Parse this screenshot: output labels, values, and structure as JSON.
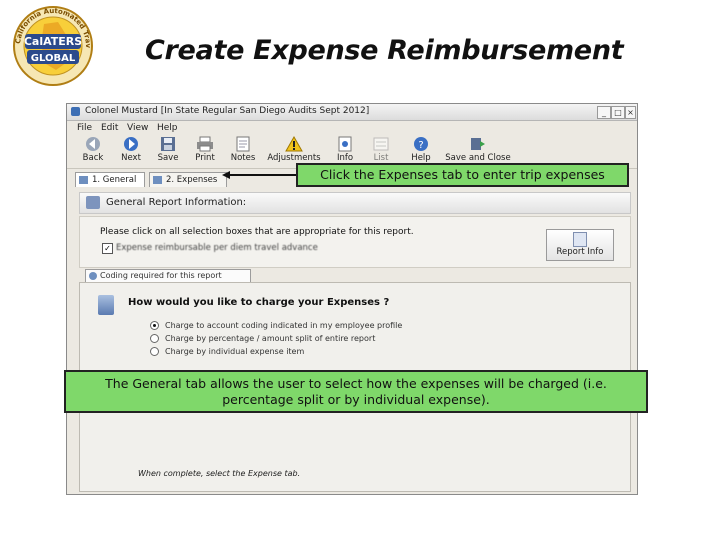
{
  "slide": {
    "title": "Create Expense Reimbursement",
    "logo_top_text": "California Automated Travel Expense",
    "logo_line1": "CalATERS",
    "logo_line2": "GLOBAL"
  },
  "window": {
    "title": "Colonel Mustard [In State Regular San Diego Audits Sept 2012]",
    "controls": [
      "_",
      "□",
      "×"
    ],
    "menu": [
      "File",
      "Edit",
      "View",
      "Help"
    ],
    "toolbar": [
      {
        "label": "Back",
        "icon": "back-arrow-icon"
      },
      {
        "label": "Next",
        "icon": "next-arrow-icon"
      },
      {
        "label": "Save",
        "icon": "save-disk-icon"
      },
      {
        "label": "Print",
        "icon": "printer-icon"
      },
      {
        "label": "Notes",
        "icon": "notes-icon"
      },
      {
        "label": "Adjustments",
        "icon": "warning-icon"
      },
      {
        "label": "Info",
        "icon": "info-icon"
      },
      {
        "label": "List",
        "icon": "list-icon"
      },
      {
        "label": "Help",
        "icon": "help-icon"
      },
      {
        "label": "Save and Close",
        "icon": "save-close-icon"
      }
    ],
    "tabs": [
      "1. General",
      "2. Expenses"
    ],
    "section_header": "General Report Information:",
    "panel_instruction": "Please click on all selection boxes that are appropriate for this report.",
    "panel_checkbox_label": "Expense reimbursable per diem travel advance",
    "report_info_label": "Report Info",
    "subtab": "Coding required for this report",
    "coding_question": "How would you like to charge your Expenses ?",
    "radio_options": [
      "Charge to account coding indicated in my employee profile",
      "Charge by percentage / amount split of entire report",
      "Charge by individual expense item"
    ],
    "selected_option_index": 0,
    "footer_hint": "When complete, select the Expense tab."
  },
  "callouts": {
    "expenses": "Click the Expenses tab to enter trip expenses",
    "general_line1": "The General tab allows the user to select how the expenses will be charged (i.e.",
    "general_line2": "percentage split or by individual expense)."
  },
  "colors": {
    "callout_fill": "#7fd86a",
    "window_bg": "#ece9e2"
  }
}
